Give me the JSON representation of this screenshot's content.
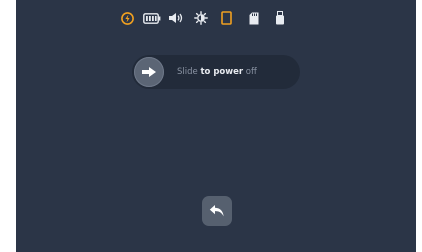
{
  "status_bar": {
    "icons": [
      "power-icon",
      "battery-icon",
      "volume-icon",
      "brightness-icon",
      "screen-icon",
      "sd-card-icon",
      "usb-drive-icon"
    ]
  },
  "colors": {
    "background": "#2b3547",
    "slider_track": "#222b3a",
    "accent_orange": "#f0a020"
  },
  "power_slider": {
    "text_pre": "Slide ",
    "text_mid": "to power",
    "text_post": " off"
  },
  "back_button": {
    "icon": "back-arrow-icon"
  }
}
